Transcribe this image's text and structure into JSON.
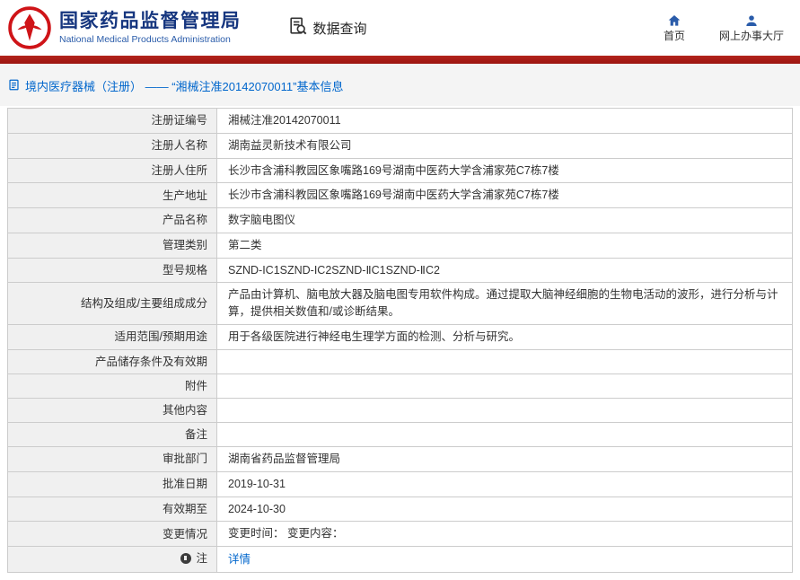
{
  "header": {
    "org_cn": "国家药品监督管理局",
    "org_en": "National Medical Products Administration",
    "query_label": "数据查询",
    "nav": [
      {
        "label": "首页"
      },
      {
        "label": "网上办事大厅"
      }
    ]
  },
  "breadcrumb": {
    "text": "境内医疗器械（注册） ——  “湘械注准20142070011”基本信息"
  },
  "table": {
    "rows": [
      {
        "label": "注册证编号",
        "value": "湘械注准20142070011"
      },
      {
        "label": "注册人名称",
        "value": "湖南益灵新技术有限公司"
      },
      {
        "label": "注册人住所",
        "value": "长沙市含浦科教园区象嘴路169号湖南中医药大学含浦家苑C7栋7楼"
      },
      {
        "label": "生产地址",
        "value": "长沙市含浦科教园区象嘴路169号湖南中医药大学含浦家苑C7栋7楼"
      },
      {
        "label": "产品名称",
        "value": "数字脑电图仪"
      },
      {
        "label": "管理类别",
        "value": "第二类"
      },
      {
        "label": "型号规格",
        "value": "SZND-IC1SZND-IC2SZND-ⅡC1SZND-ⅡC2"
      },
      {
        "label": "结构及组成/主要组成成分",
        "value": "产品由计算机、脑电放大器及脑电图专用软件构成。通过提取大脑神经细胞的生物电活动的波形，进行分析与计算，提供相关数值和/或诊断结果。"
      },
      {
        "label": "适用范围/预期用途",
        "value": "用于各级医院进行神经电生理学方面的检测、分析与研究。"
      },
      {
        "label": "产品储存条件及有效期",
        "value": ""
      },
      {
        "label": "附件",
        "value": ""
      },
      {
        "label": "其他内容",
        "value": ""
      },
      {
        "label": "备注",
        "value": ""
      },
      {
        "label": "审批部门",
        "value": "湖南省药品监督管理局"
      },
      {
        "label": "批准日期",
        "value": "2019-10-31"
      },
      {
        "label": "有效期至",
        "value": "2024-10-30"
      },
      {
        "label": "变更情况",
        "value": "变更时间： 变更内容："
      },
      {
        "label": "注",
        "value": "详情"
      }
    ]
  },
  "colors": {
    "accent_red": "#a8201a",
    "brand_blue": "#16367f",
    "icon_blue": "#2a5caa",
    "link_blue": "#0066cc"
  }
}
